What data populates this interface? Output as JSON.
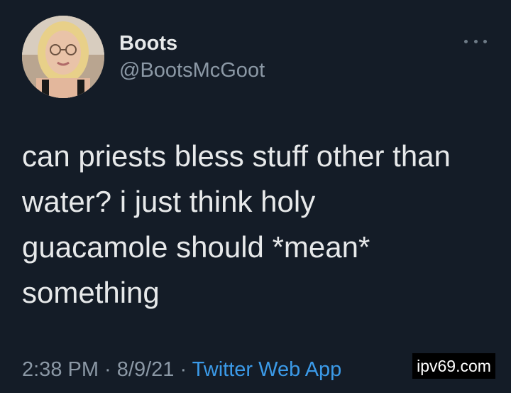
{
  "tweet": {
    "display_name": "Boots",
    "handle": "@BootsMcGoot",
    "more_icon": "more-horizontal-icon",
    "body_lines": [
      "can priests bless stuff other than",
      "water? i just think holy",
      "guacamole should *mean*",
      "something"
    ],
    "time": "2:38 PM",
    "sep1": " · ",
    "date": "8/9/21",
    "sep2": " · ",
    "source": "Twitter Web App"
  },
  "watermark": {
    "text": "ipv69.com"
  },
  "colors": {
    "background": "#141c27",
    "text_primary": "#e7e9ea",
    "text_secondary": "#8b98a5",
    "link": "#3b9ae8"
  }
}
